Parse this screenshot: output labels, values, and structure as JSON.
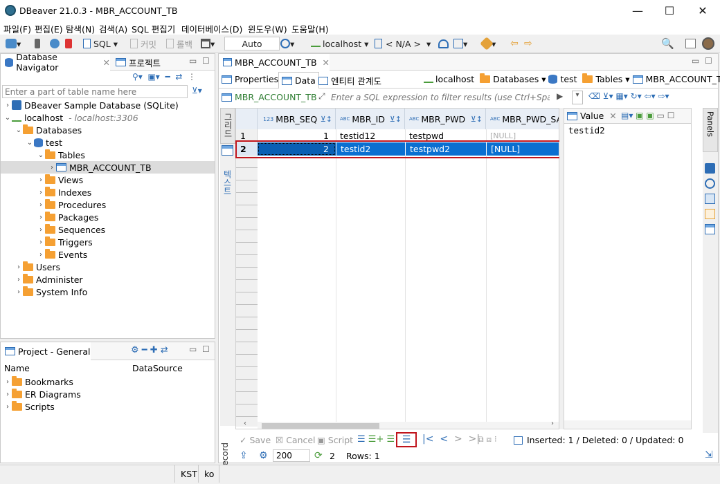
{
  "window": {
    "title": "DBeaver 21.0.3 - MBR_ACCOUNT_TB",
    "minimize": "—",
    "maximize": "☐",
    "close": "✕"
  },
  "menu": [
    "파일(F)",
    "편집(E)",
    "탐색(N)",
    "검색(A)",
    "SQL 편집기",
    "데이터베이스(D)",
    "윈도우(W)",
    "도움말(H)"
  ],
  "toolbar": {
    "sql_label": "SQL",
    "commit_label": "커밋",
    "rollback_label": "롤백",
    "transaction_mode": "Auto",
    "connection": "localhost",
    "schema": "< N/A >"
  },
  "navigator": {
    "tab_label": "Database Navigator",
    "project_tab_label": "프로젝트",
    "filter_placeholder": "Enter a part of table name here",
    "tree": {
      "sample_db": "DBeaver Sample Database (SQLite)",
      "localhost": "localhost",
      "localhost_host": "- localhost:3306",
      "databases": "Databases",
      "test": "test",
      "tables": "Tables",
      "table_selected": "MBR_ACCOUNT_TB",
      "views": "Views",
      "indexes": "Indexes",
      "procedures": "Procedures",
      "packages": "Packages",
      "sequences": "Sequences",
      "triggers": "Triggers",
      "events": "Events",
      "users": "Users",
      "administer": "Administer",
      "system_info": "System Info"
    }
  },
  "project": {
    "tab_label": "Project - General",
    "col_name": "Name",
    "col_datasource": "DataSource",
    "items": [
      "Bookmarks",
      "ER Diagrams",
      "Scripts"
    ]
  },
  "editor": {
    "tab_label": "MBR_ACCOUNT_TB",
    "subtabs": [
      "Properties",
      "Data",
      "엔티티 관계도"
    ],
    "breadcrumb": [
      "localhost",
      "Databases",
      "test",
      "Tables",
      "MBR_ACCOUNT_TB"
    ],
    "filter_table": "MBR_ACCOUNT_TB",
    "filter_placeholder": "Enter a SQL expression to filter results (use Ctrl+Space)",
    "side_tabs": [
      "그리드",
      "텍스트",
      "Record"
    ],
    "columns": [
      "MBR_SEQ",
      "MBR_ID",
      "MBR_PWD",
      "MBR_PWD_SA"
    ],
    "col_type_prefix": [
      "123",
      "ABC",
      "ABC",
      "ABC"
    ],
    "rows": [
      {
        "num": "1",
        "cells": [
          "1",
          "testid12",
          "testpwd",
          "[NULL]"
        ]
      },
      {
        "num": "2",
        "cells": [
          "2",
          "testid2",
          "testpwd2",
          "[NULL]"
        ]
      }
    ],
    "value_panel": {
      "title": "Value",
      "content": "testid2"
    },
    "panels_label": "Panels"
  },
  "bottom_bar": {
    "save": "Save",
    "cancel": "Cancel",
    "script": "Script",
    "stats": "Inserted: 1 / Deleted: 0 / Updated: 0",
    "fetch_size": "200",
    "refresh_count": "2",
    "rows": "Rows: 1"
  },
  "status": {
    "timezone": "KST",
    "locale": "ko"
  },
  "colors": {
    "accent": "#0a6fd1",
    "highlight_border": "#c0141c",
    "folder": "#f5a033"
  }
}
